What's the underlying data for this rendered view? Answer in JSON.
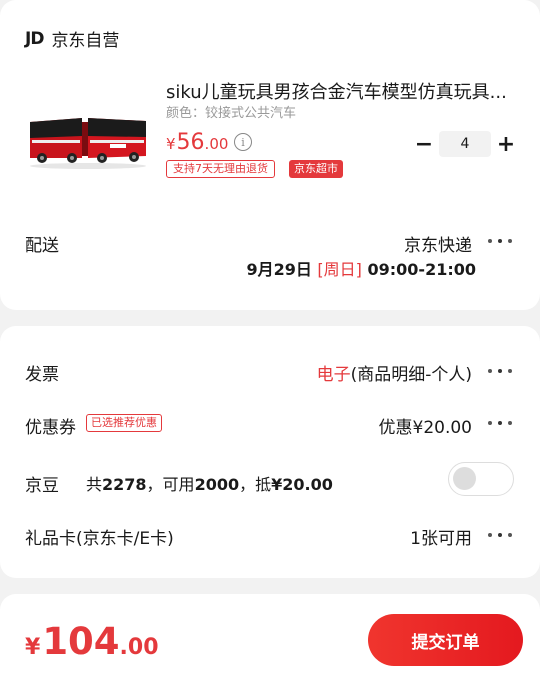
{
  "store": {
    "logo": "JD",
    "name": "京东自营"
  },
  "product": {
    "title": "siku儿童玩具男孩合金汽车模型仿真玩具...",
    "spec": "颜色：铰接式公共汽车",
    "price_currency": "¥",
    "price_int": "56",
    "price_dec": ".00",
    "tags": {
      "return_policy": "支持7天无理由退货",
      "channel": "京东超市"
    },
    "quantity": "4",
    "minus": "−",
    "plus": "+"
  },
  "delivery": {
    "label": "配送",
    "carrier": "京东快递",
    "date": "9月29日",
    "weekday": "[周日]",
    "time": "09:00-21:00"
  },
  "invoice": {
    "label": "发票",
    "type": "电子",
    "detail": "(商品明细-个人)"
  },
  "coupon": {
    "label": "优惠券",
    "tag": "已选推荐优惠",
    "value": "优惠¥20.00"
  },
  "jingdou": {
    "label": "京豆",
    "prefix_total": "共",
    "total": "2278",
    "sep1": "，可用",
    "available": "2000",
    "sep2": "，抵",
    "deduct": "¥20.00",
    "enabled": false
  },
  "giftcard": {
    "label": "礼品卡(京东卡/E卡)",
    "value": "1张可用"
  },
  "footer": {
    "total_currency": "¥",
    "total_int": "104",
    "total_dec": ".00",
    "submit_label": "提交订单"
  },
  "colors": {
    "accent": "#e4393c",
    "background": "#f2f2f2"
  }
}
